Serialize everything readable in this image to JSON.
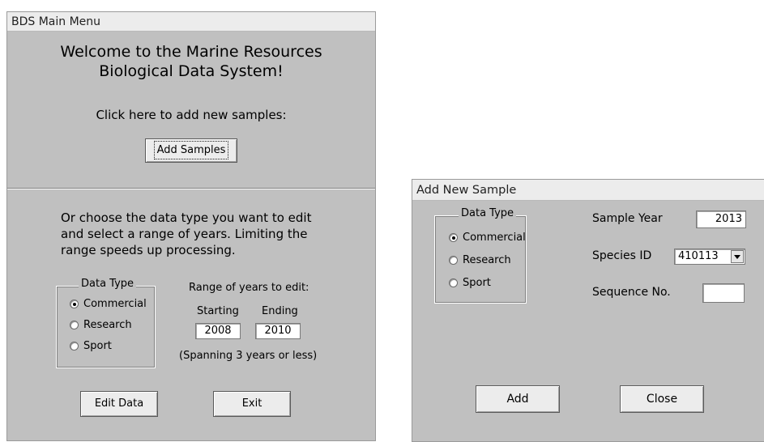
{
  "main_menu": {
    "title": "BDS Main Menu",
    "welcome_line1": "Welcome to the Marine Resources",
    "welcome_line2": "Biological Data System!",
    "add_prompt": "Click here to add new samples:",
    "add_samples_label": "Add Samples",
    "edit_prompt_line1": "Or choose the data type you want to edit",
    "edit_prompt_line2": "and select a range of years.  Limiting the",
    "edit_prompt_line3": "range speeds up processing.",
    "data_type_legend": "Data Type",
    "data_types": [
      "Commercial",
      "Research",
      "Sport"
    ],
    "selected_data_type": "Commercial",
    "range_label": "Range of years to edit:",
    "starting_label": "Starting",
    "ending_label": "Ending",
    "starting_value": "2008",
    "ending_value": "2010",
    "span_note": "(Spanning 3 years or less)",
    "edit_data_label": "Edit Data",
    "exit_label": "Exit"
  },
  "add_sample": {
    "title": "Add New Sample",
    "data_type_legend": "Data Type",
    "data_types": [
      "Commercial",
      "Research",
      "Sport"
    ],
    "selected_data_type": "Commercial",
    "sample_year_label": "Sample Year",
    "sample_year_value": "2013",
    "species_id_label": "Species ID",
    "species_id_value": "410113",
    "sequence_label": "Sequence No.",
    "sequence_value": "",
    "add_label": "Add",
    "close_label": "Close"
  }
}
